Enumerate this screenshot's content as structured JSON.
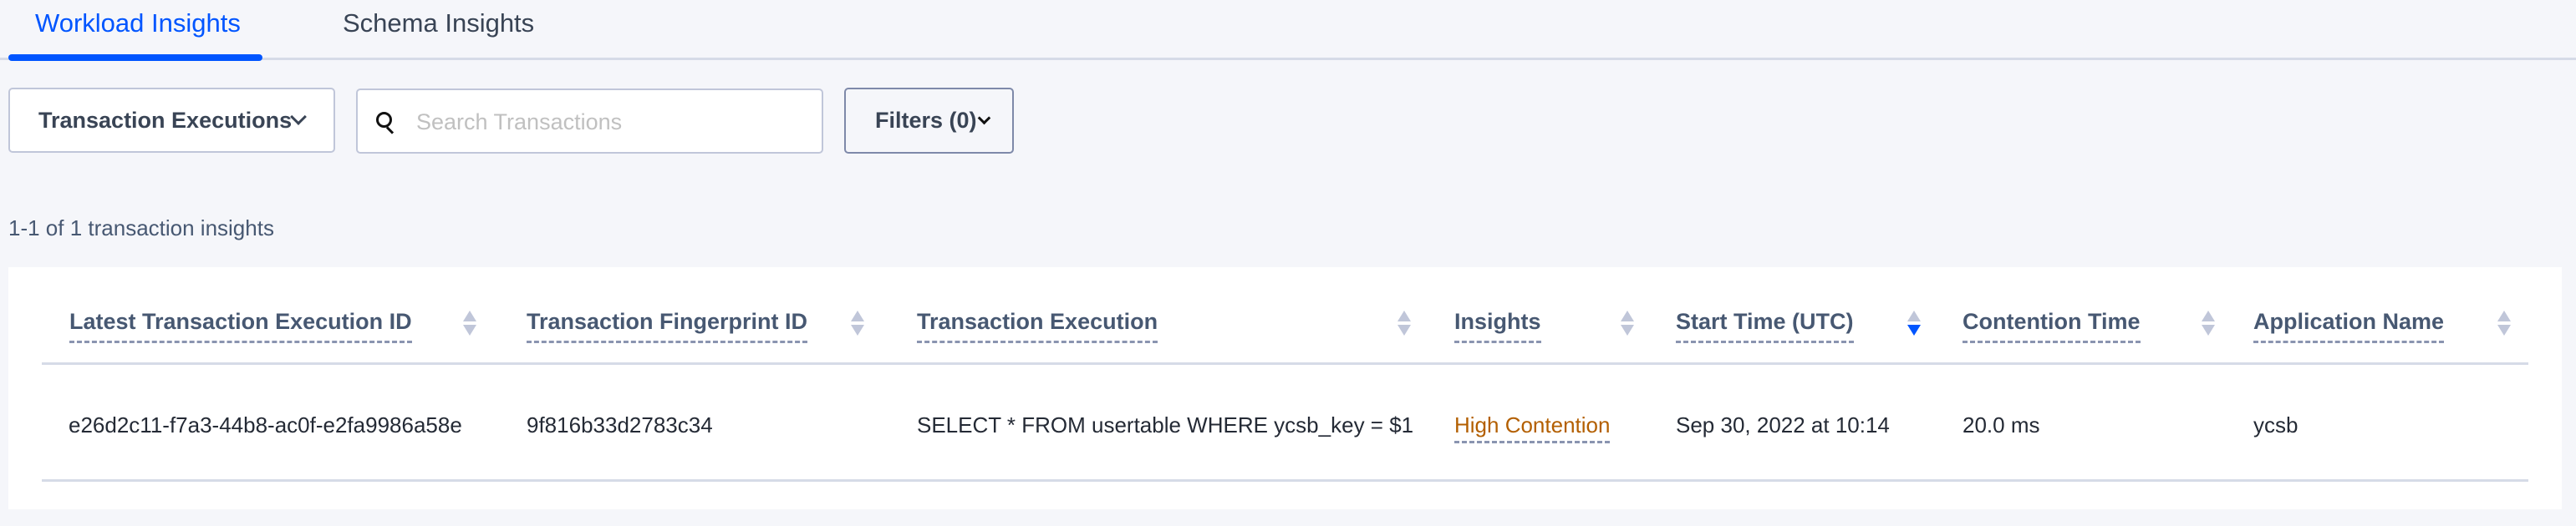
{
  "tabs": [
    {
      "label": "Workload Insights",
      "active": true
    },
    {
      "label": "Schema Insights",
      "active": false
    }
  ],
  "controls": {
    "view_dropdown": {
      "selected": "Transaction Executions",
      "icon": "chevron-down-icon"
    },
    "search": {
      "placeholder": "Search Transactions",
      "value": "",
      "icon": "search-icon"
    },
    "filters_button": {
      "label": "Filters (0)",
      "icon": "chevron-down-icon"
    }
  },
  "result_count": "1-1 of 1 transaction insights",
  "table": {
    "columns": [
      {
        "label": "Latest Transaction Execution ID",
        "sort": "none"
      },
      {
        "label": "Transaction Fingerprint ID",
        "sort": "none"
      },
      {
        "label": "Transaction Execution",
        "sort": "none"
      },
      {
        "label": "Insights",
        "sort": "none"
      },
      {
        "label": "Start Time (UTC)",
        "sort": "descending"
      },
      {
        "label": "Contention Time",
        "sort": "none"
      },
      {
        "label": "Application Name",
        "sort": "none"
      }
    ],
    "rows": [
      {
        "execution_id": "e26d2c11-f7a3-44b8-ac0f-e2fa9986a58e",
        "fingerprint_id": "9f816b33d2783c34",
        "execution": "SELECT * FROM usertable WHERE ycsb_key = $1",
        "insight": "High Contention",
        "start_time": "Sep 30, 2022 at 10:14",
        "contention_time": "20.0 ms",
        "application_name": "ycsb"
      }
    ]
  },
  "colors": {
    "accent": "#0055ff",
    "insight_warning": "#b35f00",
    "page_background": "#f5f6fa",
    "text_primary": "#394455"
  }
}
